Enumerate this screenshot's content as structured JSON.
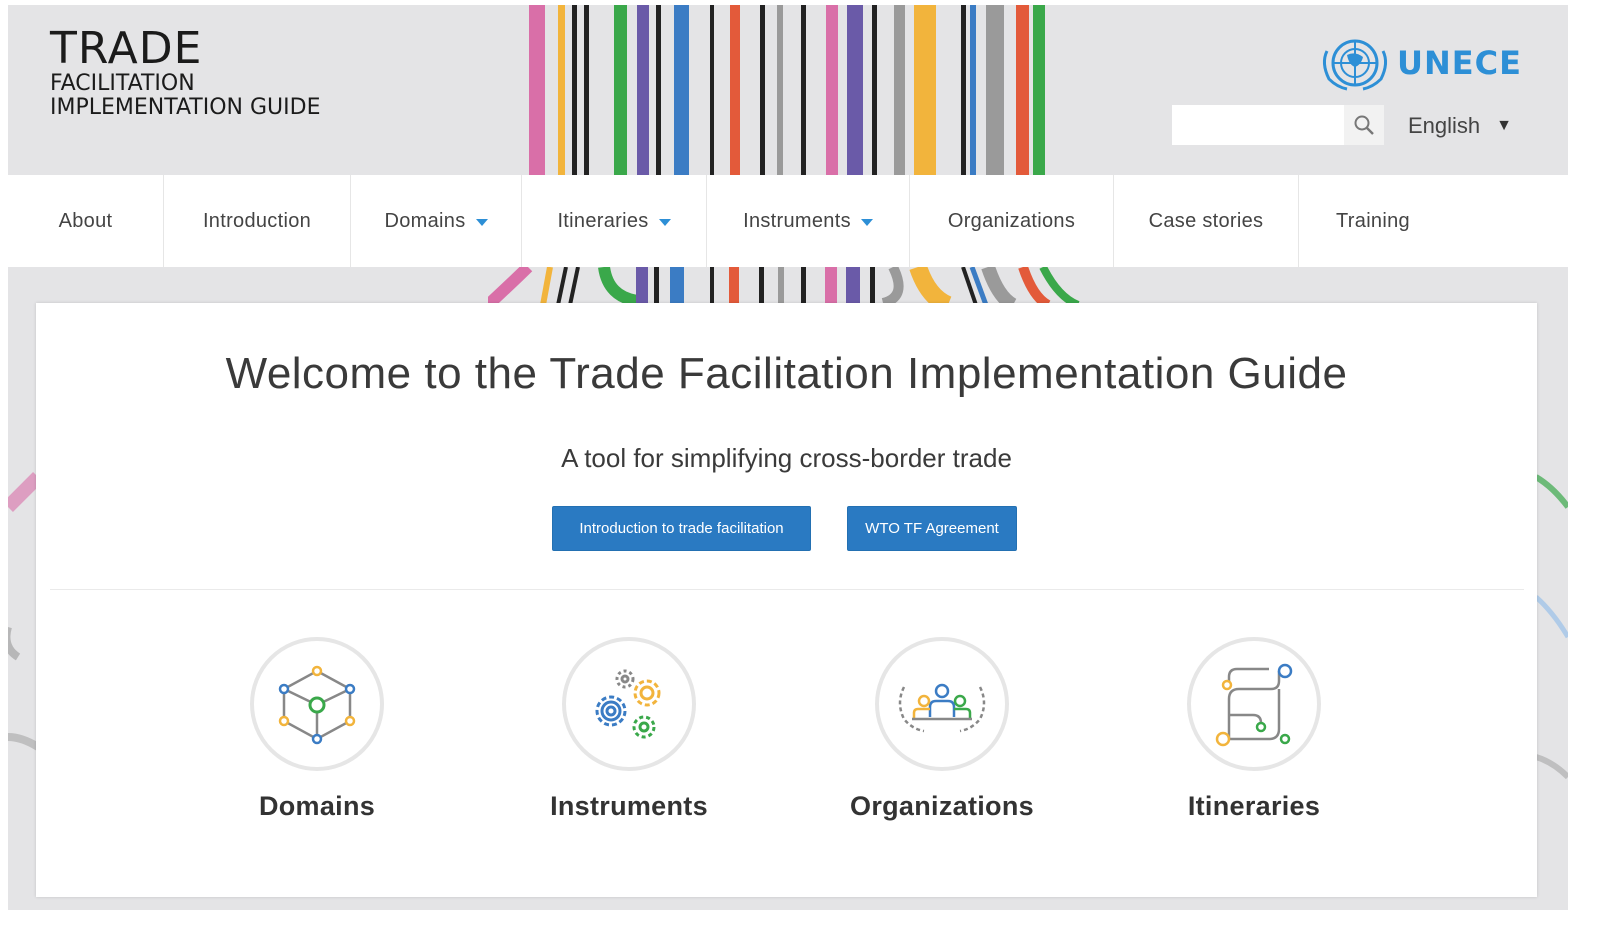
{
  "header": {
    "logo": {
      "line1": "TRADE",
      "line2": "FACILITATION",
      "line3": "IMPLEMENTATION GUIDE"
    },
    "brand": "UNECE",
    "search": {
      "placeholder": ""
    },
    "language": "English"
  },
  "nav": {
    "items": [
      {
        "label": "About",
        "dropdown": false
      },
      {
        "label": "Introduction",
        "dropdown": false
      },
      {
        "label": "Domains",
        "dropdown": true
      },
      {
        "label": "Itineraries",
        "dropdown": true
      },
      {
        "label": "Instruments",
        "dropdown": true
      },
      {
        "label": "Organizations",
        "dropdown": false
      },
      {
        "label": "Case stories",
        "dropdown": false
      },
      {
        "label": "Training",
        "dropdown": false
      }
    ]
  },
  "main": {
    "title": "Welcome to the Trade Facilitation Implementation Guide",
    "subtitle": "A tool for simplifying cross-border trade",
    "buttons": {
      "intro": "Introduction to trade facilitation",
      "wto": "WTO TF Agreement"
    },
    "tiles": [
      {
        "label": "Domains",
        "icon": "cube-network-icon"
      },
      {
        "label": "Instruments",
        "icon": "gears-icon"
      },
      {
        "label": "Organizations",
        "icon": "people-laurel-icon"
      },
      {
        "label": "Itineraries",
        "icon": "route-map-icon"
      }
    ]
  },
  "colors": {
    "accent": "#2a7ac2",
    "brand": "#2d8fd6",
    "header_bg": "#e4e4e6",
    "stripe_palette": [
      "#d96fa8",
      "#f2b43c",
      "#222222",
      "#3aa84a",
      "#6a5aa8",
      "#3b7cc4",
      "#e35a3a",
      "#9a9a9a"
    ]
  }
}
